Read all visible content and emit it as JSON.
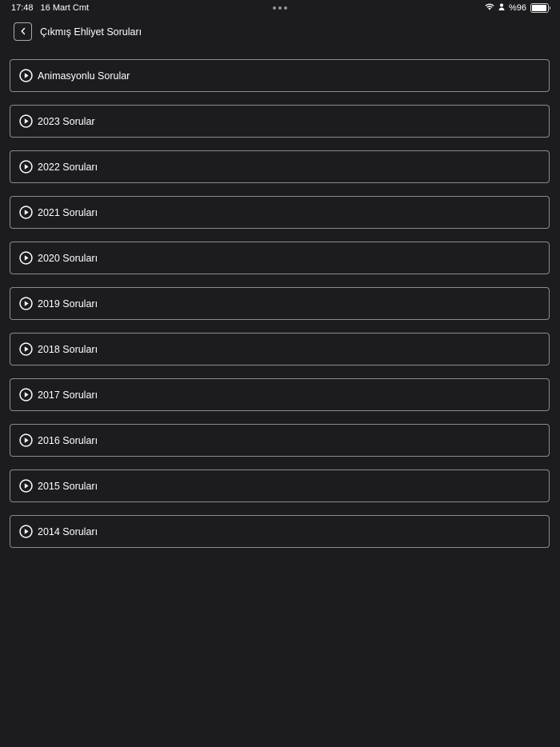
{
  "status_bar": {
    "time": "17:48",
    "date": "16 Mart Cmt",
    "battery_text": "%96",
    "battery_level": 0.96
  },
  "header": {
    "title": "Çıkmış Ehliyet Soruları"
  },
  "items": [
    {
      "label": "Animasyonlu Sorular"
    },
    {
      "label": "2023 Sorular"
    },
    {
      "label": "2022 Soruları"
    },
    {
      "label": "2021 Soruları"
    },
    {
      "label": "2020 Soruları"
    },
    {
      "label": "2019 Soruları"
    },
    {
      "label": "2018 Soruları"
    },
    {
      "label": "2017 Soruları"
    },
    {
      "label": "2016 Soruları"
    },
    {
      "label": "2015 Soruları"
    },
    {
      "label": "2014 Soruları"
    }
  ]
}
